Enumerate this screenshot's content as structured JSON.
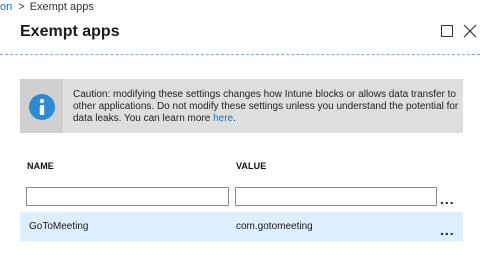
{
  "breadcrumb": {
    "link": "on",
    "separator": ">",
    "current": "Exempt apps"
  },
  "blade": {
    "title": "Exempt apps",
    "maximize_icon": "maximize-icon",
    "close_icon": "close-icon"
  },
  "info_banner": {
    "icon": "info-icon",
    "text": "Caution: modifying these settings changes how Intune blocks or allows data transfer to other applications. Do not modify these settings unless you understand the potential for data leaks. You can learn more ",
    "link_text": "here",
    "trailing": "."
  },
  "table": {
    "columns": [
      "NAME",
      "VALUE"
    ],
    "new_row": {
      "name_value": "",
      "value_value": "",
      "menu": "..."
    },
    "rows": [
      {
        "name": "GoToMeeting",
        "value": "com.gotomeeting",
        "menu": "..."
      }
    ]
  },
  "colors": {
    "accent": "#0078d4",
    "banner_bg": "#dedede",
    "row_selected_bg": "#ddeefc",
    "info_icon": "#2a8ad4"
  }
}
